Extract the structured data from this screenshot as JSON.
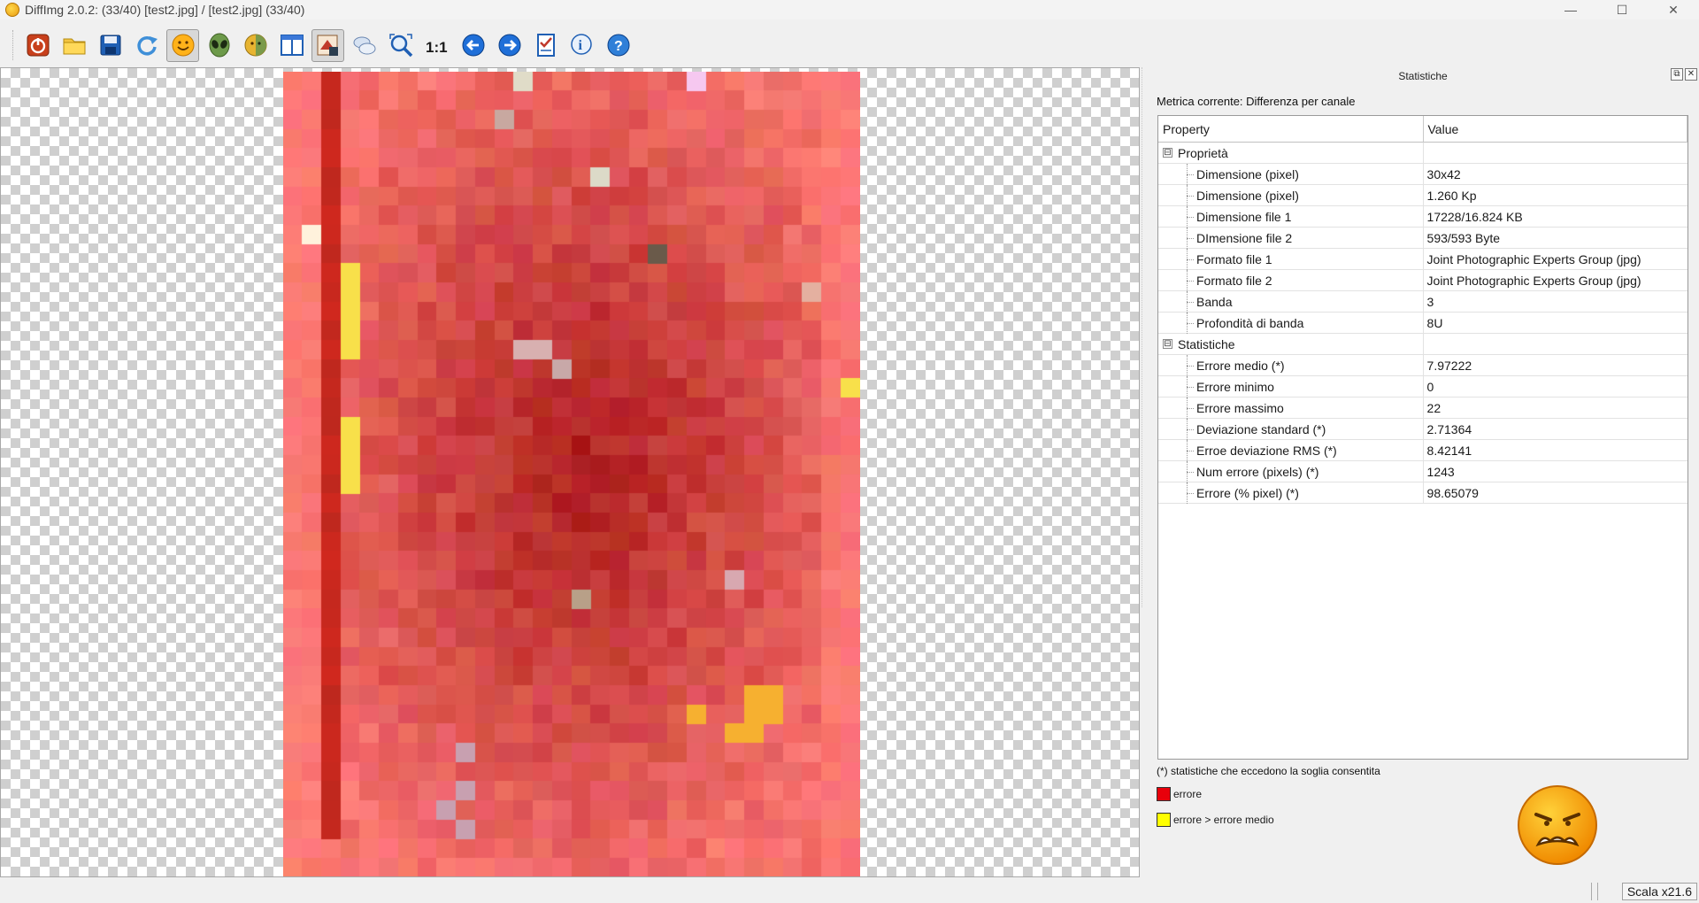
{
  "window": {
    "title": "DiffImg 2.0.2:  (33/40) [test2.jpg] / [test2.jpg] (33/40)",
    "minimize": "—",
    "maximize": "☐",
    "close": "✕"
  },
  "toolbar": {
    "buttons": [
      {
        "name": "quit-icon",
        "active": false
      },
      {
        "name": "open-folder-icon",
        "active": false
      },
      {
        "name": "save-icon",
        "active": false
      },
      {
        "name": "refresh-icon",
        "active": false
      },
      {
        "name": "smiley-icon",
        "active": true
      },
      {
        "name": "alien-icon",
        "active": false
      },
      {
        "name": "smiley-swap-icon",
        "active": false
      },
      {
        "name": "dual-panel-icon",
        "active": false
      },
      {
        "name": "difference-view-icon",
        "active": true
      },
      {
        "name": "chat-bubbles-icon",
        "active": false
      },
      {
        "name": "zoom-fit-icon",
        "active": false
      },
      {
        "name": "zoom-1to1-icon",
        "active": false
      },
      {
        "name": "previous-arrow-icon",
        "active": false
      },
      {
        "name": "next-arrow-icon",
        "active": false
      },
      {
        "name": "checklist-icon",
        "active": false
      },
      {
        "name": "info-icon",
        "active": false
      },
      {
        "name": "help-icon",
        "active": false
      }
    ],
    "zoom_1to1_label": "1:1"
  },
  "dock": {
    "title": "Statistiche",
    "float_btn": "⧉",
    "close_btn": "✕",
    "metric_label": "Metrica corrente: Differenza per canale"
  },
  "props": {
    "headers": {
      "property": "Property",
      "value": "Value"
    },
    "groups": [
      {
        "name": "Proprietà",
        "expander": "⊟",
        "rows": [
          {
            "property": "Dimensione (pixel)",
            "value": "30x42"
          },
          {
            "property": "Dimensione (pixel)",
            "value": "1.260 Kp"
          },
          {
            "property": "Dimensione file 1",
            "value": "17228/16.824 KB"
          },
          {
            "property": "DImensione file 2",
            "value": "593/593 Byte"
          },
          {
            "property": "Formato file 1",
            "value": "Joint Photographic Experts Group (jpg)"
          },
          {
            "property": "Formato file 2",
            "value": "Joint Photographic Experts Group (jpg)"
          },
          {
            "property": "Banda",
            "value": "3"
          },
          {
            "property": "Profondità di banda",
            "value": "8U"
          }
        ]
      },
      {
        "name": "Statistiche",
        "expander": "⊟",
        "rows": [
          {
            "property": "Errore medio (*)",
            "value": "7.97222"
          },
          {
            "property": "Errore minimo",
            "value": "0"
          },
          {
            "property": "Errore massimo",
            "value": "22"
          },
          {
            "property": "Deviazione standard (*)",
            "value": "2.71364"
          },
          {
            "property": "Erroe deviazione RMS (*)",
            "value": "8.42141"
          },
          {
            "property": "Num errore (pixels) (*)",
            "value": "1243"
          },
          {
            "property": "Errore (% pixel) (*)",
            "value": "98.65079"
          }
        ]
      }
    ]
  },
  "legend": {
    "footnote": "(*) statistiche che eccedono la soglia consentita",
    "items": [
      {
        "label": "errore",
        "color": "#e8000b"
      },
      {
        "label": "errore > errore medio",
        "color": "#ffff00"
      }
    ]
  },
  "result_face": "sad-face-icon",
  "statusbar": {
    "scale": "Scala x21.6"
  },
  "colors": {
    "accent": "#3b78d8",
    "error_red": "#e8000b",
    "error_yellow": "#ffff00"
  }
}
